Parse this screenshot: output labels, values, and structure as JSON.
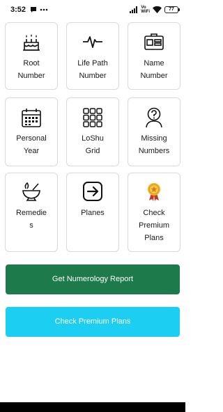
{
  "status_bar": {
    "time": "3:52",
    "network_label": "Vo\nWiFi",
    "battery": "77",
    "icons": [
      "chat-bubble-icon",
      "more-dots-icon",
      "signal-icon",
      "wifi-icon",
      "battery-icon"
    ]
  },
  "cards": [
    {
      "id": "root-number",
      "label": "Root\nNumber",
      "icon": "birthday-cake-icon"
    },
    {
      "id": "life-path-number",
      "label": "Life Path\nNumber",
      "icon": "heartbeat-icon"
    },
    {
      "id": "name-number",
      "label": "Name\nNumber",
      "icon": "name-badge-icon"
    },
    {
      "id": "personal-year",
      "label": "Personal\nYear",
      "icon": "calendar-icon"
    },
    {
      "id": "loshu-grid",
      "label": "LoShu\nGrid",
      "icon": "grid-icon"
    },
    {
      "id": "missing-numbers",
      "label": "Missing\nNumbers",
      "icon": "user-question-icon"
    },
    {
      "id": "remedies",
      "label": "Remedie\ns",
      "icon": "mortar-pestle-icon"
    },
    {
      "id": "planes",
      "label": "Planes",
      "icon": "arrow-right-box-icon"
    },
    {
      "id": "check-premium-plans",
      "label": "Check\nPremium\nPlans",
      "icon": "medal-icon"
    }
  ],
  "buttons": {
    "report": "Get Numerology Report",
    "premium": "Check Premium Plans"
  },
  "colors": {
    "report_button": "#1d7a4a",
    "premium_button": "#1dcef3",
    "card_border": "#d9d9d9"
  }
}
